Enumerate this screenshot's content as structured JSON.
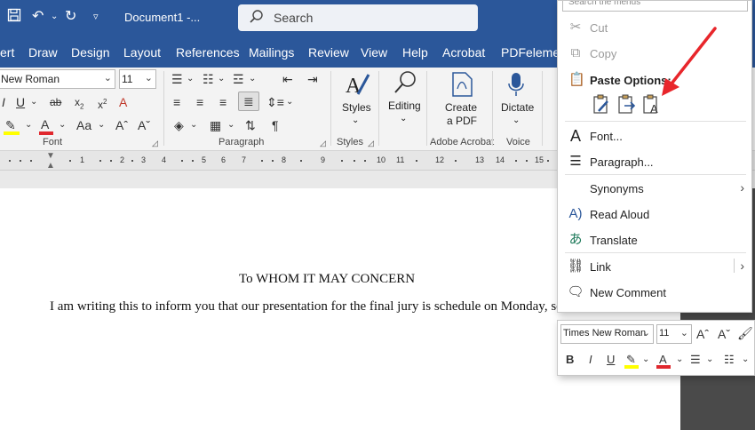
{
  "titlebar": {
    "doc_title": "Document1  -...",
    "search_placeholder": "Search"
  },
  "menu_tabs": [
    "ert",
    "Draw",
    "Design",
    "Layout",
    "References",
    "Mailings",
    "Review",
    "View",
    "Help",
    "Acrobat",
    "PDFelemen"
  ],
  "ribbon": {
    "font_name": "New Roman",
    "font_size": "11",
    "groups": {
      "font": "Font",
      "paragraph": "Paragraph",
      "styles": "Styles",
      "adobe": "Adobe Acrobat",
      "voice": "Voice"
    },
    "styles_label": "Styles",
    "editing_label": "Editing",
    "create_pdf_line1": "Create",
    "create_pdf_line2": "a PDF",
    "dictate_label": "Dictate",
    "change_case": "Aa",
    "grow_font": "A^",
    "shrink_font": "A˅",
    "pilcrow": "¶"
  },
  "ruler_numbers": [
    "1",
    "2",
    "3",
    "4",
    "5",
    "6",
    "7",
    "8",
    "9",
    "10",
    "11",
    "12",
    "13",
    "14",
    "15"
  ],
  "document": {
    "heading": "To WHOM IT MAY CONCERN",
    "body": "I am writing this to inform you that our presentation for the final jury is schedule on Monday, so"
  },
  "context_menu": {
    "search_placeholder": "Search the menus",
    "cut": "Cut",
    "copy": "Copy",
    "paste_options": "Paste Options:",
    "font": "Font...",
    "paragraph": "Paragraph...",
    "synonyms": "Synonyms",
    "read_aloud": "Read Aloud",
    "translate": "Translate",
    "link": "Link",
    "new_comment": "New Comment"
  },
  "mini_toolbar": {
    "font_name": "Times New Roman",
    "font_size": "11",
    "bold": "B",
    "italic": "I",
    "underline": "U"
  },
  "colors": {
    "accent": "#2b579a",
    "highlight": "#ffff00",
    "font_color": "#e0282e",
    "annotation_arrow": "#e8262b"
  }
}
